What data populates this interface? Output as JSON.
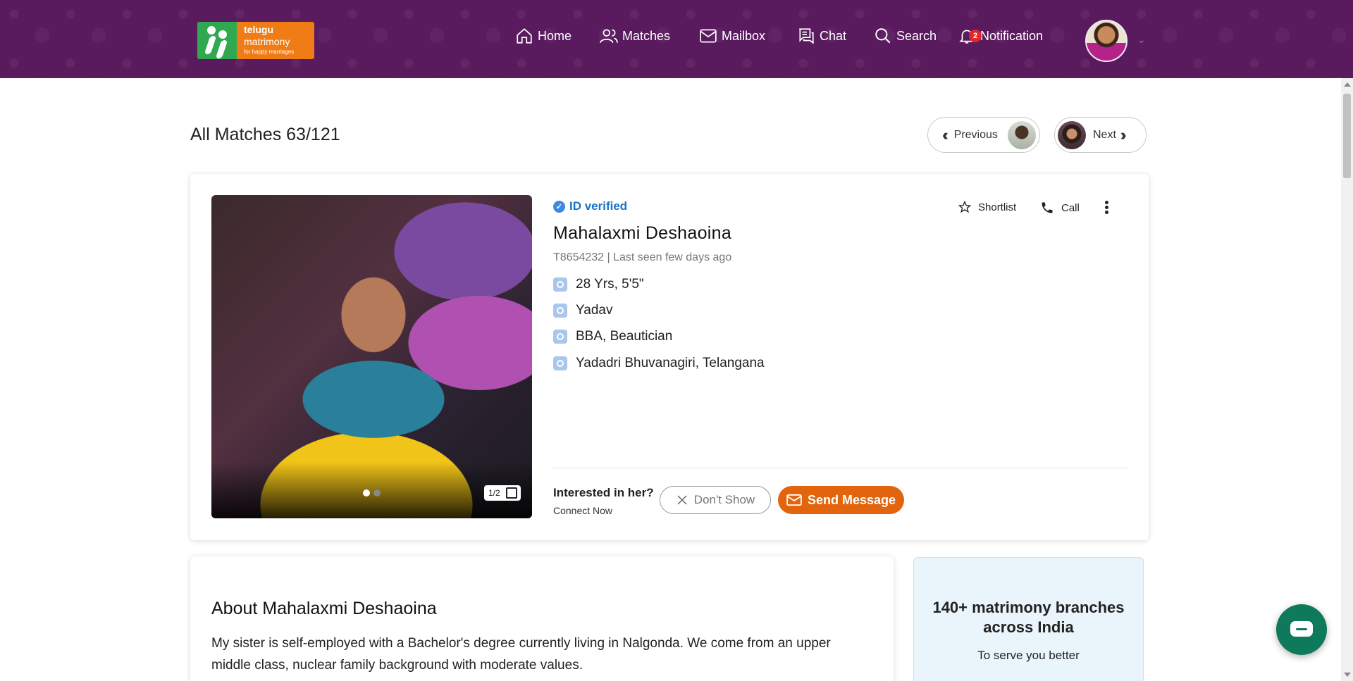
{
  "header": {
    "logo": {
      "line1": "telugu",
      "line2": "matrimony",
      "tagline": "for happy marriages"
    },
    "nav": [
      {
        "label": "Home",
        "icon": "home-icon"
      },
      {
        "label": "Matches",
        "icon": "users-icon"
      },
      {
        "label": "Mailbox",
        "icon": "mail-icon"
      },
      {
        "label": "Chat",
        "icon": "chat-icon"
      },
      {
        "label": "Search",
        "icon": "search-icon"
      },
      {
        "label": "Notification",
        "icon": "bell-icon",
        "badge": "2"
      }
    ]
  },
  "page": {
    "title": "All Matches 63/121",
    "previous_label": "Previous",
    "next_label": "Next"
  },
  "profile": {
    "verified_label": "ID verified",
    "name": "Mahalaxmi Deshaoina",
    "id_line": "T8654232 | Last seen few days ago",
    "attributes": [
      {
        "icon": "age-icon",
        "text": "28 Yrs, 5'5\""
      },
      {
        "icon": "caste-icon",
        "text": "Yadav"
      },
      {
        "icon": "education-icon",
        "text": "BBA, Beautician"
      },
      {
        "icon": "location-icon",
        "text": "Yadadri Bhuvanagiri, Telangana"
      }
    ],
    "photo_counter": "1/2",
    "shortlist_label": "Shortlist",
    "call_label": "Call",
    "interested_label": "Interested in her?",
    "connect_label": "Connect Now",
    "dont_show_label": "Don't Show",
    "send_message_label": "Send Message"
  },
  "about": {
    "title": "About Mahalaxmi Deshaoina",
    "text": "My sister is self-employed with a Bachelor's degree currently living in Nalgonda. We come from an upper middle class, nuclear family background with moderate values."
  },
  "sidebar": {
    "title": "140+ matrimony branches across India",
    "subtitle": "To serve you better"
  },
  "colors": {
    "header_bg": "#5a1a5e",
    "accent_orange": "#e2640c",
    "verified_blue": "#1a73c8",
    "chat_green": "#0e7a5b"
  }
}
